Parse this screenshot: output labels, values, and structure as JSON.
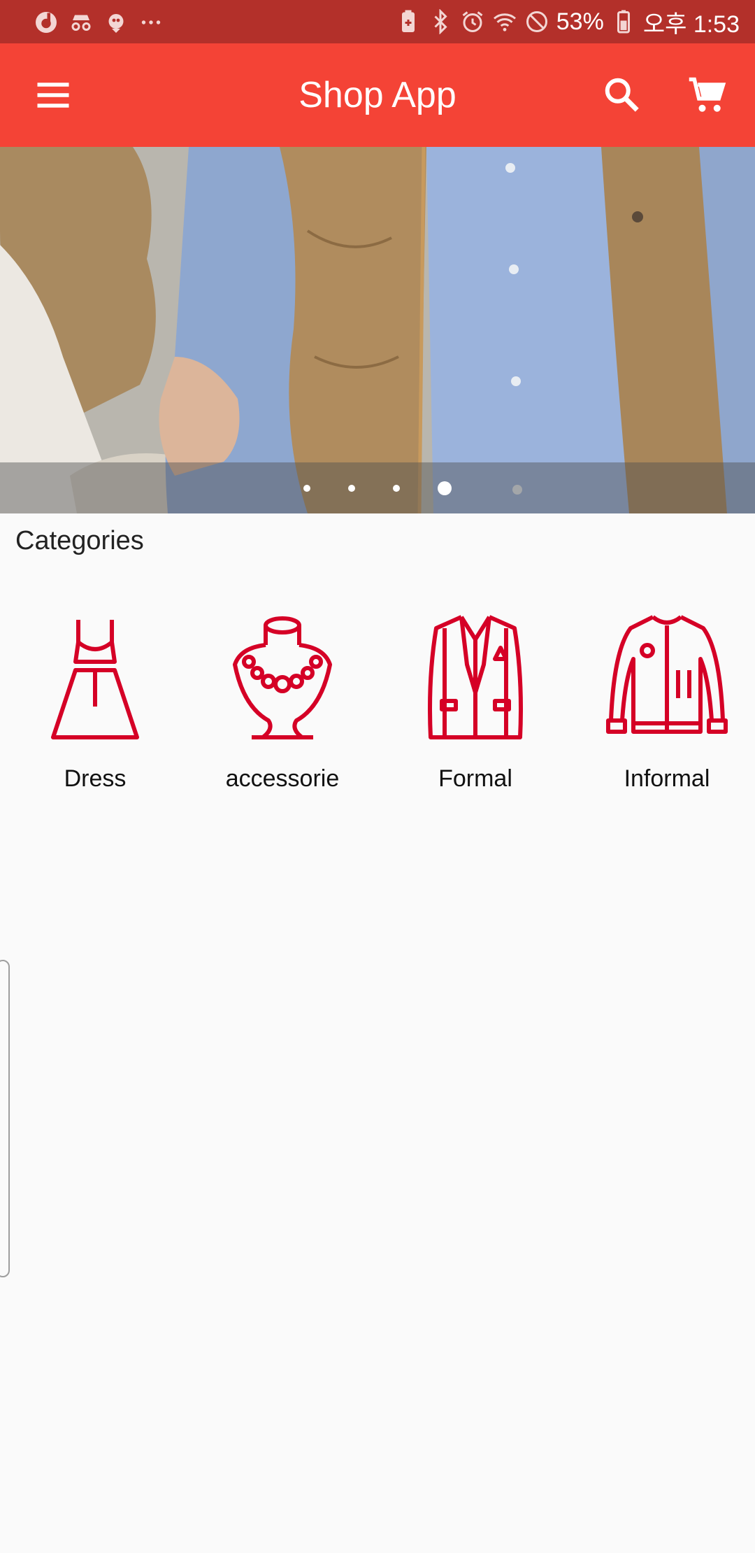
{
  "status_bar": {
    "left_icons": [
      "notification-app-icon",
      "incognito-icon",
      "bird-app-icon",
      "more-dots-icon"
    ],
    "right_icons": [
      "battery-saver-icon",
      "bluetooth-icon",
      "alarm-icon",
      "wifi-icon",
      "do-not-disturb-icon",
      "battery-icon"
    ],
    "battery_percent": "53%",
    "time": "오후 1:53"
  },
  "app_bar": {
    "title": "Shop App",
    "menu_icon": "menu-icon",
    "search_icon": "search-icon",
    "cart_icon": "cart-icon"
  },
  "banner": {
    "image": "couple-in-jacket-photo",
    "slides_total": 4,
    "active_slide": 4
  },
  "categories": {
    "heading": "Categories",
    "items": [
      {
        "label": "Dress",
        "icon": "dress-icon"
      },
      {
        "label": "accessorie",
        "icon": "necklace-icon"
      },
      {
        "label": "Formal",
        "icon": "blazer-icon"
      },
      {
        "label": "Informal",
        "icon": "jacket-icon"
      }
    ]
  },
  "colors": {
    "status_bar": "#b3302a",
    "app_bar": "#f44336",
    "category_icon": "#d50026",
    "background": "#fafafa"
  }
}
